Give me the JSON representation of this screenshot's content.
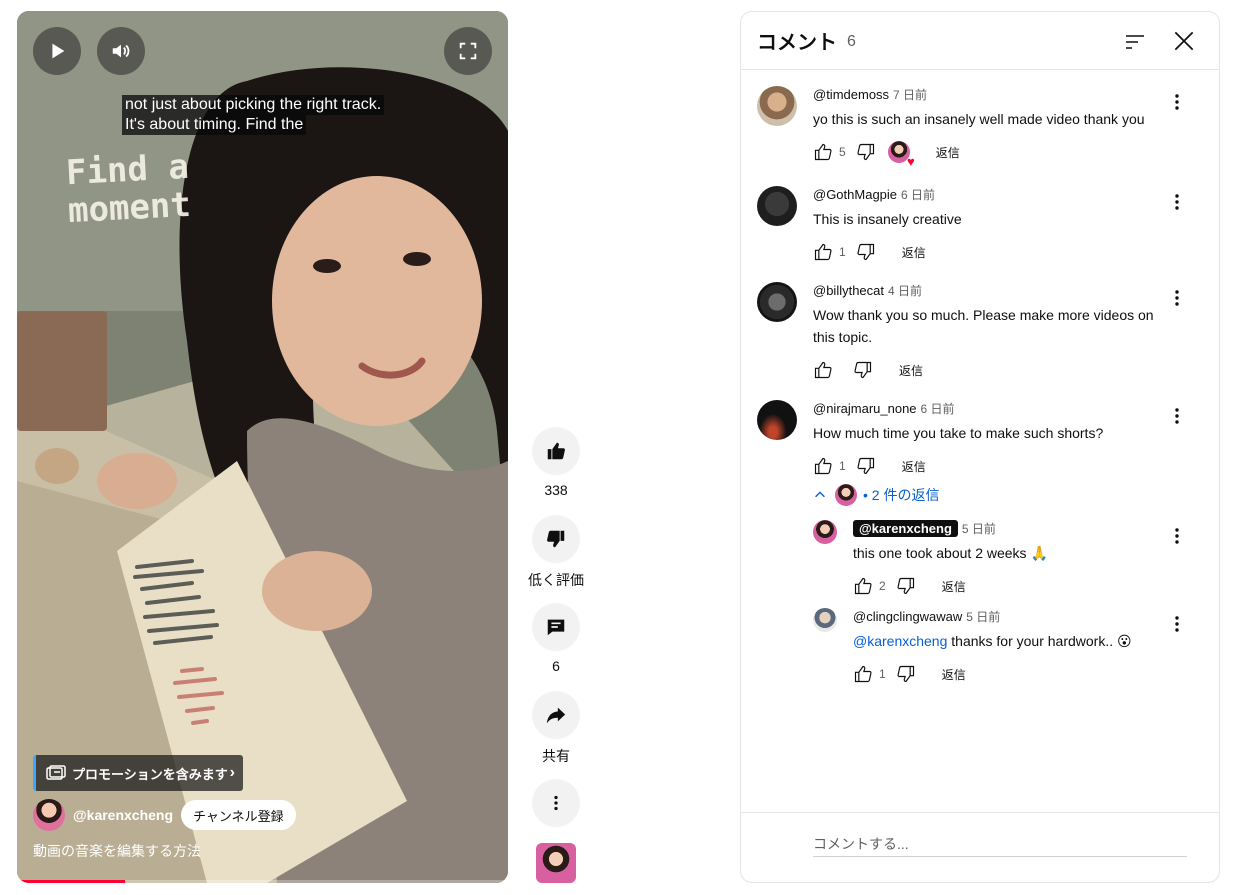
{
  "video": {
    "caption_line1": "not just about picking the right track.",
    "caption_line2": "It's about timing. Find the",
    "overlay_line1": "Find a",
    "overlay_line2": "moment",
    "promo_label": "プロモーションを含みます",
    "channel_name": "@karenxcheng",
    "subscribe_label": "チャンネル登録",
    "title": "動画の音楽を編集する方法",
    "progress": 0.22
  },
  "actions": {
    "like_count": "338",
    "dislike_label": "低く評価",
    "comment_count": "6",
    "share_label": "共有"
  },
  "comments_panel": {
    "title": "コメント",
    "count": "6",
    "reply_label": "返信",
    "placeholder": "コメントする...",
    "replies_toggle": "2 件の返信",
    "comments": [
      {
        "author": "@timdemoss",
        "time": "7 日前",
        "text": "yo this is such an insanely well made video thank you",
        "likes": "5"
      },
      {
        "author": "@GothMagpie",
        "time": "6 日前",
        "text": "This is insanely creative",
        "likes": "1"
      },
      {
        "author": "@billythecat",
        "time": "4 日前",
        "text": "Wow thank you so much. Please make more videos on this topic.",
        "likes": ""
      },
      {
        "author": "@nirajmaru_none",
        "time": "6 日前",
        "text": "How much time you take to make such shorts?",
        "likes": "1"
      }
    ],
    "replies": [
      {
        "author": "@karenxcheng",
        "time": "5 日前",
        "text": "this one took about 2 weeks 🙏",
        "likes": "2"
      },
      {
        "author": "@clingclingwawaw",
        "time": "5 日前",
        "mention": "@karenxcheng",
        "text": " thanks for your hardwork.. 😮",
        "likes": "1"
      }
    ]
  },
  "icons": [
    "play-icon",
    "volume-icon",
    "fullscreen-icon",
    "promo-icon",
    "thumbs-up-icon",
    "thumbs-down-icon",
    "comment-icon",
    "share-icon",
    "more-icon",
    "sort-icon",
    "close-icon",
    "chevron-up-icon"
  ],
  "colors": {
    "accent_blue": "#065fd4",
    "progress_red": "#ff0033",
    "heart_red": "#ff0033"
  }
}
